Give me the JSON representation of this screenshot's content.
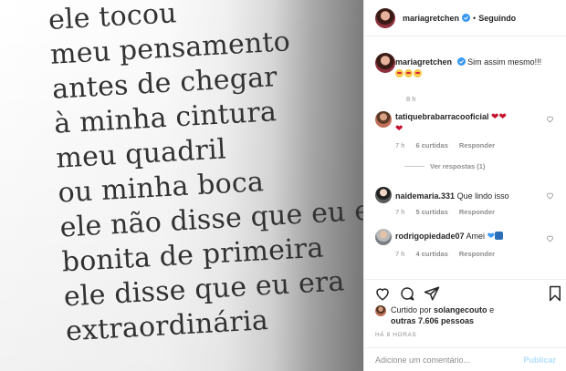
{
  "photo": {
    "lines": [
      "ele tocou",
      "meu pensamento",
      "antes de chegar",
      "à minha cintura",
      "meu quadril",
      "ou minha boca",
      "ele não disse que eu era",
      "bonita de primeira",
      "ele disse que eu era",
      "extraordinária"
    ]
  },
  "header": {
    "username": "mariagretchen",
    "separator": "•",
    "follow_state": "Seguindo"
  },
  "caption": {
    "username": "mariagretchen",
    "text": "Sim assim mesmo!!!",
    "time": "8 h"
  },
  "comments": [
    {
      "username": "tatiquebrabarracooficial",
      "text": "",
      "time": "7 h",
      "likes": "6 curtidas",
      "reply": "Responder",
      "view_replies": "Ver respostas (1)"
    },
    {
      "username": "naidemaria.331",
      "text": "Que lindo isso",
      "time": "7 h",
      "likes": "5 curtidas",
      "reply": "Responder"
    },
    {
      "username": "rodrigopiedade07",
      "text": "Amei",
      "time": "7 h",
      "likes": "4 curtidas",
      "reply": "Responder"
    }
  ],
  "liked": {
    "prefix": "Curtido por",
    "user": "solangecouto",
    "middle": "e",
    "others": "outras 7.606 pessoas"
  },
  "timestamp": "HÁ 8 HORAS",
  "add_comment": {
    "placeholder": "Adicione um comentário...",
    "publish_label": "Publicar"
  },
  "icons": {
    "verified": "verified-badge-icon",
    "heart": "heart-icon",
    "comment": "comment-icon",
    "share": "share-icon",
    "bookmark": "bookmark-icon"
  },
  "colors": {
    "verified_blue": "#3897f0",
    "muted_text": "#8e8e8e",
    "publish_disabled": "#b2dffc"
  }
}
